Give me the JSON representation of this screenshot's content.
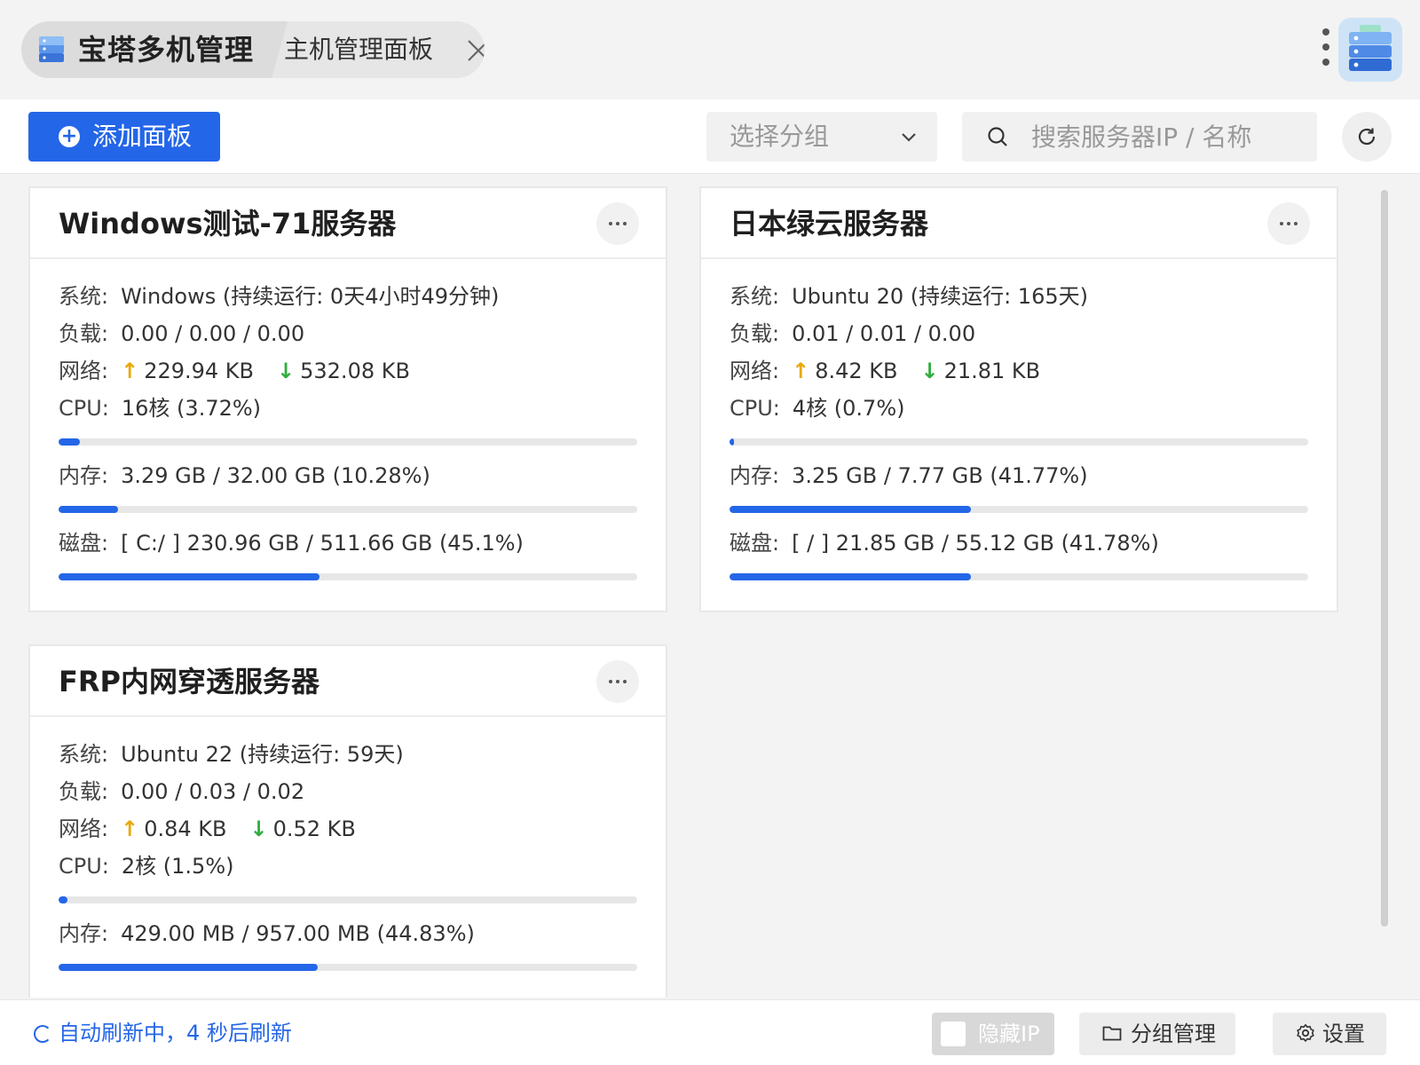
{
  "titlebar": {
    "app_title": "宝塔多机管理",
    "tab2_label": "主机管理面板"
  },
  "toolbar": {
    "add_label": "添加面板",
    "group_select": "选择分组",
    "search_placeholder": "搜索服务器IP / 名称"
  },
  "labels": {
    "system": "系统:",
    "load": "负载:",
    "network": "网络:",
    "cpu": "CPU:",
    "memory": "内存:",
    "disk": "磁盘:",
    "up_arrow": "↑",
    "down_arrow": "↓"
  },
  "servers": [
    {
      "name": "Windows测试-71服务器",
      "system": "Windows (持续运行: 0天4小时49分钟)",
      "load": "0.00 / 0.00 / 0.00",
      "net_up": "229.94 KB",
      "net_down": "532.08 KB",
      "cpu": "16核 (3.72%)",
      "cpu_percent": 3.72,
      "memory": "3.29 GB / 32.00 GB (10.28%)",
      "memory_percent": 10.28,
      "disk": "[ C:/ ] 230.96 GB / 511.66 GB (45.1%)",
      "disk_percent": 45.1
    },
    {
      "name": "日本绿云服务器",
      "system": "Ubuntu 20 (持续运行: 165天)",
      "load": "0.01 / 0.01 / 0.00",
      "net_up": "8.42 KB",
      "net_down": "21.81 KB",
      "cpu": "4核 (0.7%)",
      "cpu_percent": 0.7,
      "memory": "3.25 GB / 7.77 GB (41.77%)",
      "memory_percent": 41.77,
      "disk": "[ / ] 21.85 GB / 55.12 GB (41.78%)",
      "disk_percent": 41.78
    },
    {
      "name": "FRP内网穿透服务器",
      "system": "Ubuntu 22 (持续运行: 59天)",
      "load": "0.00 / 0.03 / 0.02",
      "net_up": "0.84 KB",
      "net_down": "0.52 KB",
      "cpu": "2核 (1.5%)",
      "cpu_percent": 1.5,
      "memory": "429.00 MB / 957.00 MB (44.83%)",
      "memory_percent": 44.83
    }
  ],
  "footer": {
    "auto_refresh": "自动刷新中，4 秒后刷新",
    "hide_ip": "隐藏IP",
    "group_manage": "分组管理",
    "settings": "设置"
  },
  "colors": {
    "accent": "#2466e8",
    "upload": "#e8a90c",
    "download": "#2fae3f"
  }
}
